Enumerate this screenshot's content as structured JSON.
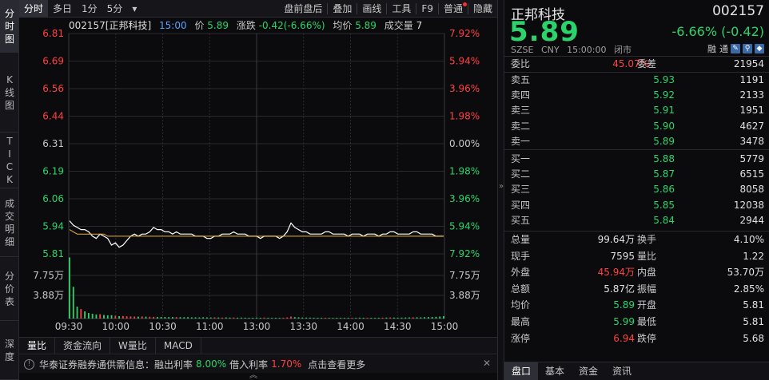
{
  "left_tabs": [
    {
      "chars": [
        "分",
        "时",
        "图"
      ],
      "active": true
    },
    {
      "chars": [
        "K",
        "线",
        "图"
      ],
      "active": false
    },
    {
      "chars": [
        "T",
        "I",
        "C",
        "K"
      ],
      "active": false
    },
    {
      "chars": [
        "成",
        "交",
        "明",
        "细"
      ],
      "active": false
    },
    {
      "chars": [
        "分",
        "价",
        "表"
      ],
      "active": false
    },
    {
      "chars": [
        "深",
        "度"
      ],
      "active": false
    }
  ],
  "toolbar": {
    "left": [
      "分时",
      "多日",
      "1分",
      "5分"
    ],
    "dropdown_glyph": "▾",
    "right": [
      "盘前盘后",
      "叠加",
      "画线",
      "工具",
      "F9",
      "普通",
      "隐藏"
    ]
  },
  "infobar": {
    "stock": "002157[正邦科技]",
    "time": "15:00",
    "price_label": "价",
    "price": "5.89",
    "change_label": "涨跌",
    "change": "-0.42(-6.66%)",
    "avg_label": "均价",
    "avg": "5.89",
    "vol_label": "成交量",
    "vol": "7"
  },
  "chart_data": {
    "type": "line",
    "price_axis_left": [
      "6.81",
      "6.69",
      "6.56",
      "6.44",
      "6.31",
      "6.19",
      "6.06",
      "5.94",
      "5.81"
    ],
    "pct_axis_right": [
      "7.92%",
      "5.94%",
      "3.96%",
      "1.98%",
      "0.00%",
      "1.98%",
      "3.96%",
      "5.94%",
      "7.92%"
    ],
    "vol_axis_left": [
      "7.75万",
      "3.88万"
    ],
    "vol_axis_right": [
      "7.75万",
      "3.88万"
    ],
    "x_ticks": [
      "09:30",
      "10:00",
      "10:30",
      "11:00",
      "13:00",
      "13:30",
      "14:00",
      "14:30",
      "15:00"
    ],
    "price_range": [
      5.81,
      6.81
    ],
    "prev_close": 6.31,
    "vol_max": 77500,
    "colors": {
      "up": "#ff4040",
      "down": "#2bd46b",
      "flat": "#c8c8c8",
      "price_line": "#ffffff",
      "avg_line": "#e8b03c"
    },
    "price_series": [
      5.96,
      5.94,
      5.93,
      5.92,
      5.92,
      5.91,
      5.89,
      5.88,
      5.9,
      5.89,
      5.88,
      5.85,
      5.86,
      5.84,
      5.85,
      5.87,
      5.89,
      5.9,
      5.89,
      5.9,
      5.9,
      5.91,
      5.93,
      5.92,
      5.92,
      5.91,
      5.91,
      5.9,
      5.91,
      5.9,
      5.9,
      5.9,
      5.9,
      5.89,
      5.89,
      5.89,
      5.88,
      5.88,
      5.89,
      5.89,
      5.9,
      5.9,
      5.9,
      5.91,
      5.9,
      5.9,
      5.9,
      5.89,
      5.89,
      5.89,
      5.88,
      5.89,
      5.89,
      5.89,
      5.89,
      5.88,
      5.89,
      5.91,
      5.95,
      5.93,
      5.92,
      5.91,
      5.91,
      5.9,
      5.9,
      5.9,
      5.9,
      5.91,
      5.91,
      5.9,
      5.9,
      5.9,
      5.9,
      5.89,
      5.9,
      5.9,
      5.9,
      5.89,
      5.9,
      5.9,
      5.9,
      5.89,
      5.9,
      5.9,
      5.91,
      5.91,
      5.9,
      5.9,
      5.9,
      5.9,
      5.91,
      5.91,
      5.9,
      5.9,
      5.9,
      5.9,
      5.89,
      5.89,
      5.89
    ],
    "avg_series": [
      5.92,
      5.91,
      5.9,
      5.9,
      5.9,
      5.9,
      5.9,
      5.9,
      5.9,
      5.9,
      5.89,
      5.89,
      5.89,
      5.89,
      5.89,
      5.89,
      5.89,
      5.89,
      5.89,
      5.89,
      5.89,
      5.89,
      5.89,
      5.89,
      5.89,
      5.89,
      5.89,
      5.89,
      5.89,
      5.89,
      5.89,
      5.89,
      5.89,
      5.89,
      5.89,
      5.89,
      5.89,
      5.89,
      5.89,
      5.89,
      5.89,
      5.89,
      5.89,
      5.89,
      5.89,
      5.89,
      5.89,
      5.89,
      5.89,
      5.89,
      5.89,
      5.89,
      5.89,
      5.89,
      5.89,
      5.89,
      5.89,
      5.89,
      5.89,
      5.89,
      5.89,
      5.89,
      5.89,
      5.89,
      5.89,
      5.89,
      5.89,
      5.89,
      5.89,
      5.89,
      5.89,
      5.89,
      5.89,
      5.89,
      5.89,
      5.89,
      5.89,
      5.89,
      5.89,
      5.89,
      5.89,
      5.89,
      5.89,
      5.89,
      5.89,
      5.89,
      5.89,
      5.89,
      5.89,
      5.89,
      5.89,
      5.89,
      5.89,
      5.89,
      5.89,
      5.89,
      5.89,
      5.89,
      5.89
    ],
    "volume_series": [
      77000,
      40000,
      15000,
      12000,
      9000,
      7000,
      6000,
      5000,
      5500,
      4500,
      4000,
      4200,
      3500,
      3000,
      3200,
      2800,
      2600,
      2500,
      2400,
      2600,
      2300,
      2200,
      2100,
      2000,
      2000,
      1900,
      1800,
      1900,
      1800,
      1700,
      1600,
      1800,
      1500,
      1500,
      1400,
      1600,
      1400,
      1300,
      1500,
      1300,
      1200,
      1400,
      1200,
      1300,
      1100,
      1200,
      1100,
      1000,
      1000,
      1100,
      1000,
      1200,
      1000,
      900,
      1000,
      900,
      1000,
      1400,
      2500,
      1800,
      1500,
      1300,
      1200,
      1100,
      1000,
      1000,
      900,
      1000,
      900,
      900,
      1000,
      900,
      900,
      1000,
      900,
      900,
      1100,
      1000,
      900,
      1000,
      900,
      1000,
      1100,
      1200,
      1300,
      1200,
      1100,
      1200,
      1300,
      1400,
      1500,
      1600,
      1500,
      1800,
      1900,
      2000,
      2200,
      2500,
      3000
    ],
    "volume_dir": [
      "d",
      "d",
      "d",
      "u",
      "d",
      "d",
      "d",
      "d",
      "u",
      "d",
      "d",
      "d",
      "u",
      "d",
      "u",
      "u",
      "u",
      "u",
      "d",
      "u",
      "d",
      "u",
      "u",
      "d",
      "d",
      "d",
      "d",
      "d",
      "u",
      "d",
      "d",
      "d",
      "d",
      "d",
      "d",
      "d",
      "d",
      "d",
      "u",
      "d",
      "u",
      "d",
      "d",
      "u",
      "d",
      "d",
      "d",
      "d",
      "d",
      "d",
      "d",
      "u",
      "d",
      "d",
      "d",
      "d",
      "u",
      "u",
      "u",
      "d",
      "d",
      "d",
      "d",
      "d",
      "d",
      "d",
      "d",
      "u",
      "d",
      "d",
      "d",
      "d",
      "d",
      "d",
      "u",
      "d",
      "d",
      "d",
      "u",
      "d",
      "d",
      "d",
      "u",
      "d",
      "u",
      "d",
      "d",
      "d",
      "d",
      "d",
      "u",
      "d",
      "d",
      "d",
      "d",
      "d",
      "d",
      "d",
      "d"
    ]
  },
  "indicator_tabs": [
    "量比",
    "资金流向",
    "W量比",
    "MACD"
  ],
  "ticker": {
    "icon": "!",
    "prefix": "华泰证券融券通供需信息：融出利率",
    "rate1": "8.00%",
    "mid": "借入利率",
    "rate2": "1.70%",
    "suffix": "点击查看更多",
    "close": "✕",
    "chevron": "︽"
  },
  "collapse_glyph": "»",
  "quote": {
    "name": "正邦科技",
    "code": "002157",
    "price": "5.89",
    "change": "-6.66% (-0.42)",
    "meta": [
      "SZSE",
      "CNY",
      "15:00:00",
      "闭市"
    ],
    "badges": [
      "融",
      "通"
    ],
    "weibi_label": "委比",
    "weibi": "45.07%",
    "weicha_label": "委差",
    "weicha": "21954",
    "asks": [
      {
        "label": "卖五",
        "price": "5.93",
        "vol": "1191"
      },
      {
        "label": "卖四",
        "price": "5.92",
        "vol": "2133"
      },
      {
        "label": "卖三",
        "price": "5.91",
        "vol": "1951"
      },
      {
        "label": "卖二",
        "price": "5.90",
        "vol": "4627"
      },
      {
        "label": "卖一",
        "price": "5.89",
        "vol": "3478"
      }
    ],
    "bids": [
      {
        "label": "买一",
        "price": "5.88",
        "vol": "5779"
      },
      {
        "label": "买二",
        "price": "5.87",
        "vol": "6515"
      },
      {
        "label": "买三",
        "price": "5.86",
        "vol": "8058"
      },
      {
        "label": "买四",
        "price": "5.85",
        "vol": "12038"
      },
      {
        "label": "买五",
        "price": "5.84",
        "vol": "2944"
      }
    ],
    "stats": [
      {
        "l1": "总量",
        "v1": "99.64万",
        "c1": "wht",
        "l2": "换手",
        "v2": "4.10%",
        "c2": "wht"
      },
      {
        "l1": "现手",
        "v1": "7595",
        "c1": "wht",
        "l2": "量比",
        "v2": "1.22",
        "c2": "wht"
      },
      {
        "l1": "外盘",
        "v1": "45.94万",
        "c1": "red",
        "l2": "内盘",
        "v2": "53.70万",
        "c2": "grn"
      },
      {
        "l1": "总额",
        "v1": "5.87亿",
        "c1": "wht",
        "l2": "振幅",
        "v2": "2.85%",
        "c2": "wht"
      },
      {
        "l1": "均价",
        "v1": "5.89",
        "c1": "grn",
        "l2": "开盘",
        "v2": "5.81",
        "c2": "grn"
      },
      {
        "l1": "最高",
        "v1": "5.99",
        "c1": "grn",
        "l2": "最低",
        "v2": "5.81",
        "c2": "grn"
      },
      {
        "l1": "涨停",
        "v1": "6.94",
        "c1": "red",
        "l2": "跌停",
        "v2": "5.68",
        "c2": "grn"
      }
    ],
    "tabs": [
      "盘口",
      "基本",
      "资金",
      "资讯"
    ]
  }
}
